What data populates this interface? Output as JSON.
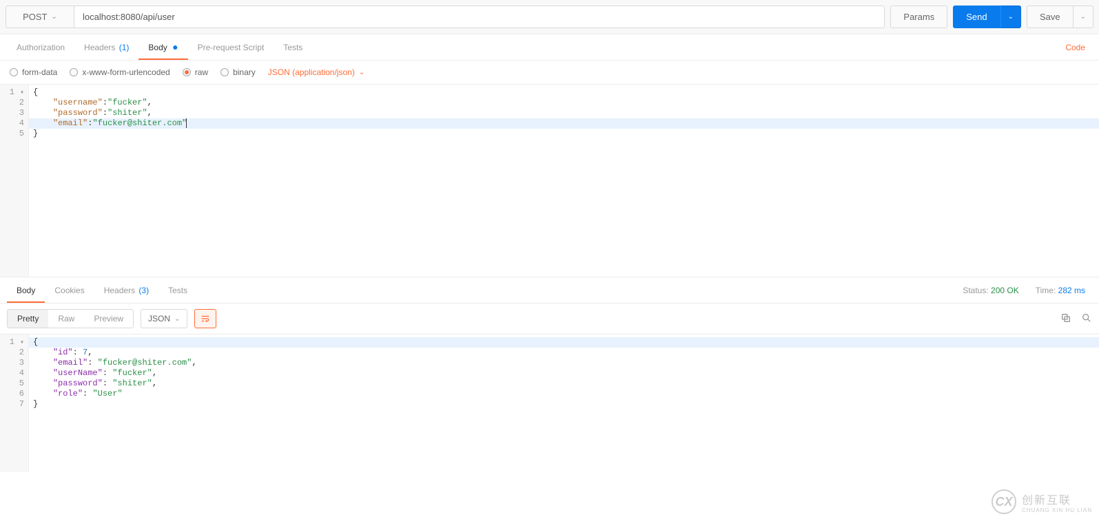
{
  "request": {
    "method": "POST",
    "url": "localhost:8080/api/user",
    "buttons": {
      "params": "Params",
      "send": "Send",
      "save": "Save"
    },
    "tabs": {
      "authorization": "Authorization",
      "headers": "Headers",
      "headers_count": "(1)",
      "body": "Body",
      "prerequest": "Pre-request Script",
      "tests": "Tests",
      "code": "Code"
    },
    "body_types": {
      "form_data": "form-data",
      "urlencoded": "x-www-form-urlencoded",
      "raw": "raw",
      "binary": "binary",
      "content_type": "JSON (application/json)"
    },
    "body_lines": [
      {
        "n": "1",
        "fold": true,
        "segments": [
          {
            "t": "brace",
            "v": "{"
          }
        ]
      },
      {
        "n": "2",
        "segments": [
          {
            "t": "indent",
            "v": "    "
          },
          {
            "t": "key",
            "v": "\"username\""
          },
          {
            "t": "colon",
            "v": ":"
          },
          {
            "t": "str",
            "v": "\"fucker\""
          },
          {
            "t": "plain",
            "v": ","
          }
        ]
      },
      {
        "n": "3",
        "segments": [
          {
            "t": "indent",
            "v": "    "
          },
          {
            "t": "key",
            "v": "\"password\""
          },
          {
            "t": "colon",
            "v": ":"
          },
          {
            "t": "str",
            "v": "\"shiter\""
          },
          {
            "t": "plain",
            "v": ","
          }
        ]
      },
      {
        "n": "4",
        "hl": true,
        "segments": [
          {
            "t": "indent",
            "v": "    "
          },
          {
            "t": "key",
            "v": "\"email\""
          },
          {
            "t": "colon",
            "v": ":"
          },
          {
            "t": "str",
            "v": "\"fucker@shiter.com\""
          },
          {
            "t": "cursor",
            "v": ""
          }
        ]
      },
      {
        "n": "5",
        "segments": [
          {
            "t": "brace",
            "v": "}"
          }
        ]
      }
    ]
  },
  "response": {
    "tabs": {
      "body": "Body",
      "cookies": "Cookies",
      "headers": "Headers",
      "headers_count": "(3)",
      "tests": "Tests"
    },
    "status_label": "Status:",
    "status_value": "200 OK",
    "time_label": "Time:",
    "time_value": "282 ms",
    "viewmodes": {
      "pretty": "Pretty",
      "raw": "Raw",
      "preview": "Preview"
    },
    "lang": "JSON",
    "body_lines": [
      {
        "n": "1",
        "fold": true,
        "hl": true,
        "segments": [
          {
            "t": "brace",
            "v": "{"
          }
        ]
      },
      {
        "n": "2",
        "segments": [
          {
            "t": "indent",
            "v": "    "
          },
          {
            "t": "key",
            "v": "\"id\""
          },
          {
            "t": "colon",
            "v": ": "
          },
          {
            "t": "num",
            "v": "7"
          },
          {
            "t": "plain",
            "v": ","
          }
        ]
      },
      {
        "n": "3",
        "segments": [
          {
            "t": "indent",
            "v": "    "
          },
          {
            "t": "key",
            "v": "\"email\""
          },
          {
            "t": "colon",
            "v": ": "
          },
          {
            "t": "str",
            "v": "\"fucker@shiter.com\""
          },
          {
            "t": "plain",
            "v": ","
          }
        ]
      },
      {
        "n": "4",
        "segments": [
          {
            "t": "indent",
            "v": "    "
          },
          {
            "t": "key",
            "v": "\"userName\""
          },
          {
            "t": "colon",
            "v": ": "
          },
          {
            "t": "str",
            "v": "\"fucker\""
          },
          {
            "t": "plain",
            "v": ","
          }
        ]
      },
      {
        "n": "5",
        "segments": [
          {
            "t": "indent",
            "v": "    "
          },
          {
            "t": "key",
            "v": "\"password\""
          },
          {
            "t": "colon",
            "v": ": "
          },
          {
            "t": "str",
            "v": "\"shiter\""
          },
          {
            "t": "plain",
            "v": ","
          }
        ]
      },
      {
        "n": "6",
        "segments": [
          {
            "t": "indent",
            "v": "    "
          },
          {
            "t": "key",
            "v": "\"role\""
          },
          {
            "t": "colon",
            "v": ": "
          },
          {
            "t": "str",
            "v": "\"User\""
          }
        ]
      },
      {
        "n": "7",
        "segments": [
          {
            "t": "brace",
            "v": "}"
          }
        ]
      }
    ]
  },
  "watermark": {
    "brand": "创新互联",
    "sub": "CHUANG XIN HU LIAN",
    "mark": "CX"
  }
}
